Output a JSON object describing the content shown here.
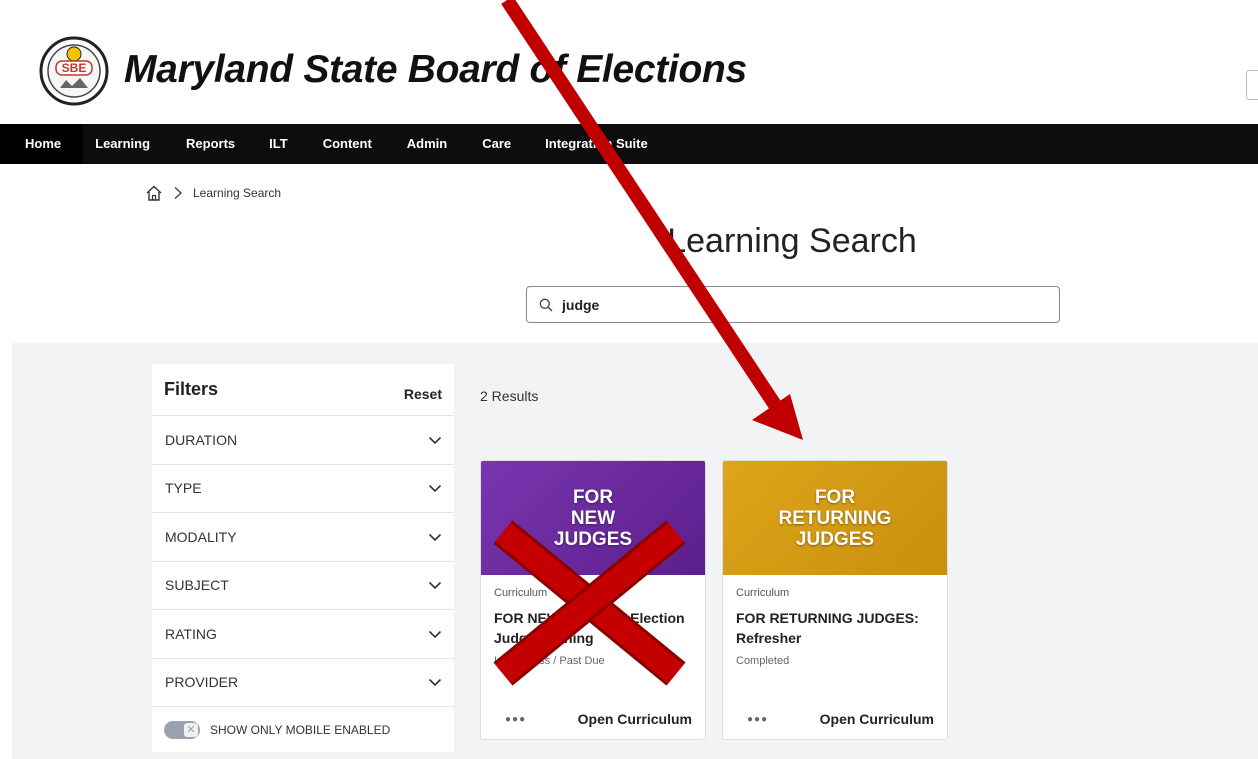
{
  "header": {
    "logo_text": "SBE",
    "site_title": "Maryland State Board of Elections"
  },
  "nav": {
    "items": [
      {
        "label": "Home"
      },
      {
        "label": "Learning"
      },
      {
        "label": "Reports"
      },
      {
        "label": "ILT"
      },
      {
        "label": "Content"
      },
      {
        "label": "Admin"
      },
      {
        "label": "Care"
      },
      {
        "label": "Integration Suite"
      }
    ]
  },
  "breadcrumb": {
    "current": "Learning Search"
  },
  "page": {
    "title": "Learning Search"
  },
  "search": {
    "value": "judge",
    "placeholder": ""
  },
  "filters": {
    "title": "Filters",
    "reset_label": "Reset",
    "items": [
      {
        "label": "DURATION"
      },
      {
        "label": "TYPE"
      },
      {
        "label": "MODALITY"
      },
      {
        "label": "SUBJECT"
      },
      {
        "label": "RATING"
      },
      {
        "label": "PROVIDER"
      }
    ],
    "mobile_toggle_label": "SHOW ONLY MOBILE ENABLED"
  },
  "results": {
    "count_label": "2 Results",
    "cards": [
      {
        "thumb_text_lines": [
          "FOR",
          "NEW",
          "JUDGES"
        ],
        "thumb_color": "#6b2a9e",
        "kind": "Curriculum",
        "title": "FOR NEW JUDGES: Election Judge Training",
        "status": "In Progress / Past Due",
        "action_label": "Open Curriculum"
      },
      {
        "thumb_text_lines": [
          "FOR",
          "RETURNING",
          "JUDGES"
        ],
        "thumb_color": "#d4a017",
        "kind": "Curriculum",
        "title": "FOR RETURNING JUDGES: Refresher",
        "status": "Completed",
        "action_label": "Open Curriculum"
      }
    ]
  },
  "colors": {
    "nav_bg": "#0d0d0d",
    "annotation_red": "#c00000",
    "page_bg": "#f2f3f5"
  }
}
